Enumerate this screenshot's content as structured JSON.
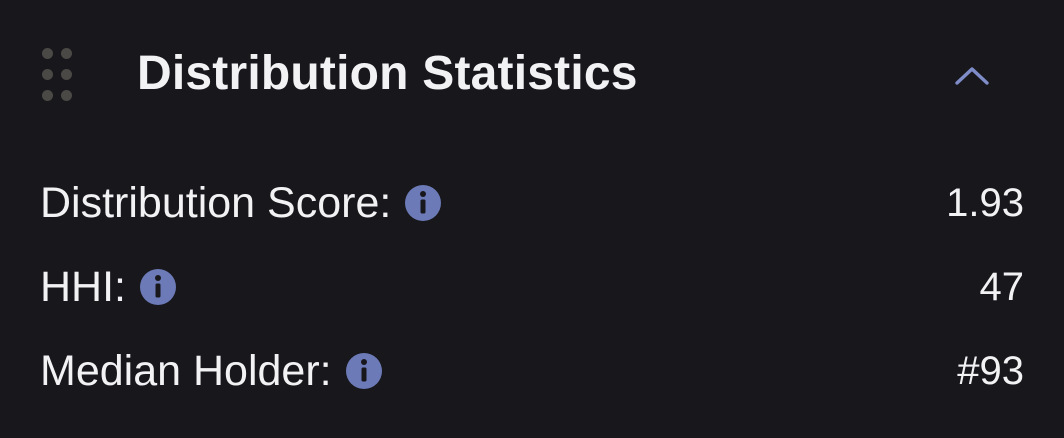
{
  "panel": {
    "title": "Distribution Statistics",
    "icons": {
      "drag": "drag-handle-icon",
      "collapse": "chevron-up-icon",
      "info": "info-icon"
    }
  },
  "stats": [
    {
      "label": "Distribution Score:",
      "value": "1.93"
    },
    {
      "label": "HHI:",
      "value": "47"
    },
    {
      "label": "Median Holder:",
      "value": "#93"
    }
  ],
  "colors": {
    "background": "#18171c",
    "text": "#f2f2f4",
    "accent": "#7e8cc8",
    "info_icon_fill": "#6c7bb8",
    "handle_dots": "#4a4945"
  }
}
